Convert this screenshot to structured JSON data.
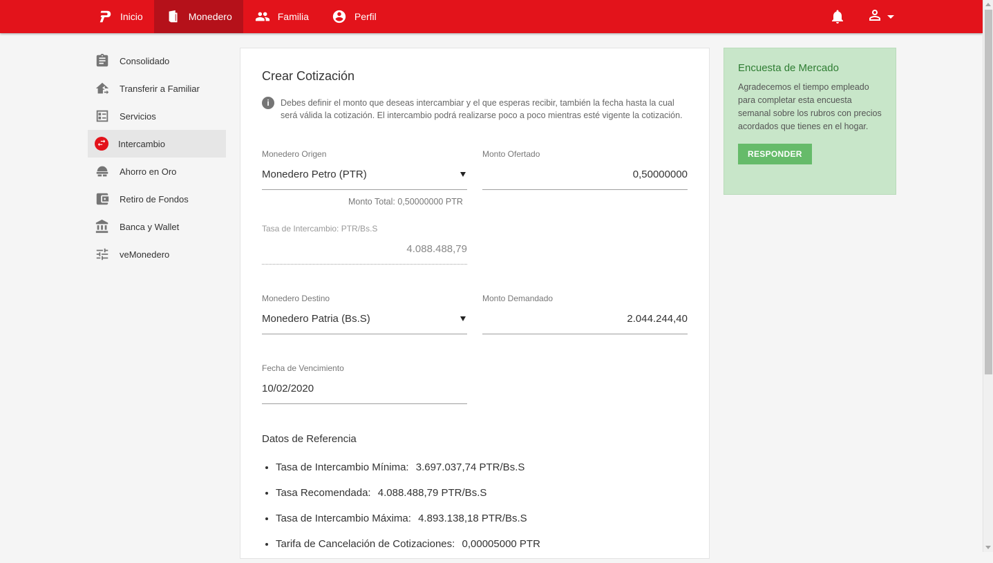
{
  "topbar": {
    "nav": [
      {
        "label": "Inicio",
        "icon": "petro-logo-icon"
      },
      {
        "label": "Monedero",
        "icon": "wallet-icon",
        "active": true
      },
      {
        "label": "Familia",
        "icon": "people-icon"
      },
      {
        "label": "Perfil",
        "icon": "account-circle-icon"
      }
    ],
    "accent": "#e3131b"
  },
  "sidebar": {
    "items": [
      {
        "label": "Consolidado",
        "icon": "clipboard-icon"
      },
      {
        "label": "Transferir a Familiar",
        "icon": "home-transfer-icon"
      },
      {
        "label": "Servicios",
        "icon": "services-list-icon"
      },
      {
        "label": "Intercambio",
        "icon": "exchange-icon",
        "active": true
      },
      {
        "label": "Ahorro en Oro",
        "icon": "gold-bars-icon"
      },
      {
        "label": "Retiro de Fondos",
        "icon": "wallet-withdraw-icon"
      },
      {
        "label": "Banca y Wallet",
        "icon": "bank-icon"
      },
      {
        "label": "veMonedero",
        "icon": "sliders-icon"
      }
    ]
  },
  "form": {
    "title": "Crear Cotización",
    "info": "Debes definir el monto que deseas intercambiar y el que esperas recibir, también la fecha hasta la cual será válida la cotización. El intercambio podrá realizarse poco a poco mientras esté vigente la cotización.",
    "origen": {
      "label": "Monedero Origen",
      "value": "Monedero Petro (PTR)"
    },
    "ofertado": {
      "label": "Monto Ofertado",
      "value": "0,50000000"
    },
    "monto_total": "Monto Total: 0,50000000 PTR",
    "tasa": {
      "label": "Tasa de Intercambio: PTR/Bs.S",
      "value": "4.088.488,79"
    },
    "destino": {
      "label": "Monedero Destino",
      "value": "Monedero Patria (Bs.S)"
    },
    "demandado": {
      "label": "Monto Demandado",
      "value": "2.044.244,40"
    },
    "fecha": {
      "label": "Fecha de Vencimiento",
      "value": "10/02/2020"
    },
    "ref_title": "Datos de Referencia",
    "refs": [
      {
        "label": "Tasa de Intercambio Mínima:",
        "value": "3.697.037,74 PTR/Bs.S"
      },
      {
        "label": "Tasa Recomendada:",
        "value": "4.088.488,79 PTR/Bs.S"
      },
      {
        "label": "Tasa de Intercambio Máxima:",
        "value": "4.893.138,18 PTR/Bs.S"
      },
      {
        "label": "Tarifa de Cancelación de Cotizaciones:",
        "value": "0,00005000 PTR"
      }
    ]
  },
  "survey": {
    "title": "Encuesta de Mercado",
    "text": "Agradecemos el tiempo empleado para completar esta encuesta semanal sobre los rubros con precios acordados que tienes en el hogar.",
    "button": "RESPONDER"
  }
}
